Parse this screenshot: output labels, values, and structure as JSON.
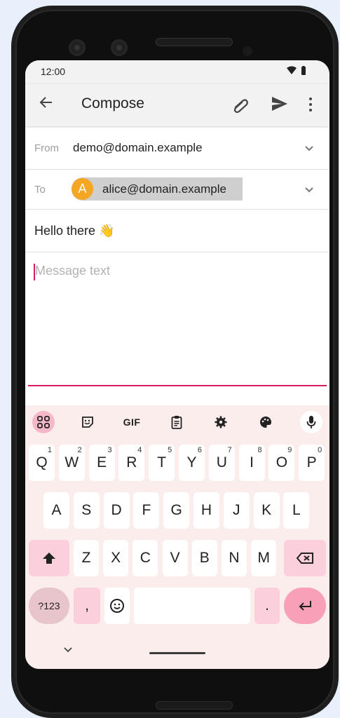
{
  "status_bar": {
    "time": "12:00"
  },
  "app_bar": {
    "title": "Compose"
  },
  "fields": {
    "from_label": "From",
    "from_value": "demo@domain.example",
    "to_label": "To",
    "to_chip_initial": "A",
    "to_chip_email": "alice@domain.example",
    "subject_text": "Hello there",
    "subject_emoji": "👋",
    "body_placeholder": "Message text"
  },
  "keyboard": {
    "toolbar": {
      "gif_label": "GIF"
    },
    "row1": [
      {
        "key": "Q",
        "hint": "1"
      },
      {
        "key": "W",
        "hint": "2"
      },
      {
        "key": "E",
        "hint": "3"
      },
      {
        "key": "R",
        "hint": "4"
      },
      {
        "key": "T",
        "hint": "5"
      },
      {
        "key": "Y",
        "hint": "6"
      },
      {
        "key": "U",
        "hint": "7"
      },
      {
        "key": "I",
        "hint": "8"
      },
      {
        "key": "O",
        "hint": "9"
      },
      {
        "key": "P",
        "hint": "0"
      }
    ],
    "row2": [
      "A",
      "S",
      "D",
      "F",
      "G",
      "H",
      "J",
      "K",
      "L"
    ],
    "row3": [
      "Z",
      "X",
      "C",
      "V",
      "B",
      "N",
      "M"
    ],
    "row4": {
      "symbols": "?123",
      "comma": ",",
      "period": "."
    }
  },
  "colors": {
    "accent": "#d81b60",
    "avatar": "#f5a623",
    "keyboard_bg": "#fceded"
  }
}
